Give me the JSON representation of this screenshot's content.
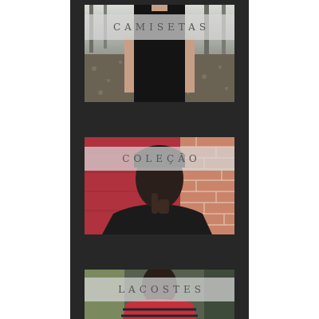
{
  "categories": [
    {
      "label": "CAMISETAS"
    },
    {
      "label": "COLEÇÃO"
    },
    {
      "label": "LACOSTES"
    }
  ],
  "colors": {
    "background": "#272727",
    "band": "#d7d7d7",
    "label_text": "#555555"
  },
  "icons": {
    "card_1_photo": "man-black-tshirt-photo",
    "card_2_photo": "man-brick-wall-photo",
    "card_3_photo": "man-striped-shirt-photo"
  }
}
